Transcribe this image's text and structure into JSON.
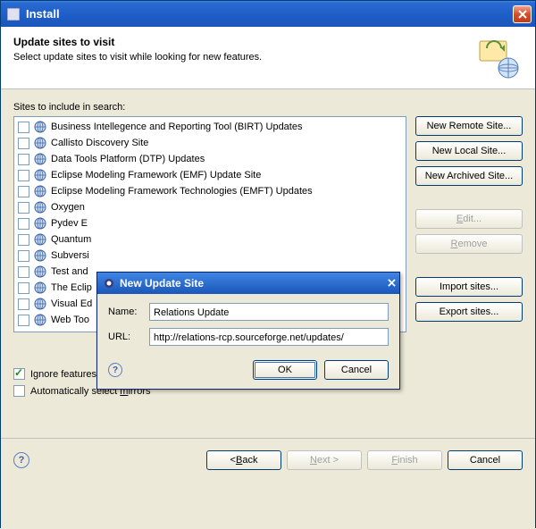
{
  "window": {
    "title": "Install"
  },
  "banner": {
    "title": "Update sites to visit",
    "desc": "Select update sites to visit while looking for new features."
  },
  "list_label": "Sites to include in search:",
  "sites": [
    {
      "label": "Business Intellegence and Reporting Tool (BIRT) Updates"
    },
    {
      "label": "Callisto Discovery Site"
    },
    {
      "label": "Data Tools Platform (DTP) Updates"
    },
    {
      "label": "Eclipse Modeling Framework (EMF) Update Site"
    },
    {
      "label": "Eclipse Modeling Framework Technologies (EMFT) Updates"
    },
    {
      "label": "Oxygen"
    },
    {
      "label": "Pydev E"
    },
    {
      "label": "Quantum"
    },
    {
      "label": "Subversi"
    },
    {
      "label": "Test and"
    },
    {
      "label": "The Eclip"
    },
    {
      "label": "Visual Ed"
    },
    {
      "label": "Web Too"
    }
  ],
  "side": {
    "new_remote": "New Remote Site...",
    "new_local": "New Local Site...",
    "new_archived": "New Archived Site...",
    "edit": "Edit...",
    "remove": "Remove",
    "import": "Import sites...",
    "export": "Export sites..."
  },
  "options": {
    "ignore": "Ignore features not applicable to this environment",
    "mirrors_pre": "Automatically select ",
    "mirrors_mn": "m",
    "mirrors_post": "irrors"
  },
  "footer": {
    "back_pre": "< ",
    "back_mn": "B",
    "back_post": "ack",
    "next_mn": "N",
    "next_post": "ext >",
    "finish_mn": "F",
    "finish_post": "inish",
    "cancel": "Cancel"
  },
  "modal": {
    "title": "New Update Site",
    "name_label": "Name:",
    "name_value": "Relations Update",
    "url_label": "URL:",
    "url_value": "http://relations-rcp.sourceforge.net/updates/",
    "ok": "OK",
    "cancel": "Cancel"
  }
}
